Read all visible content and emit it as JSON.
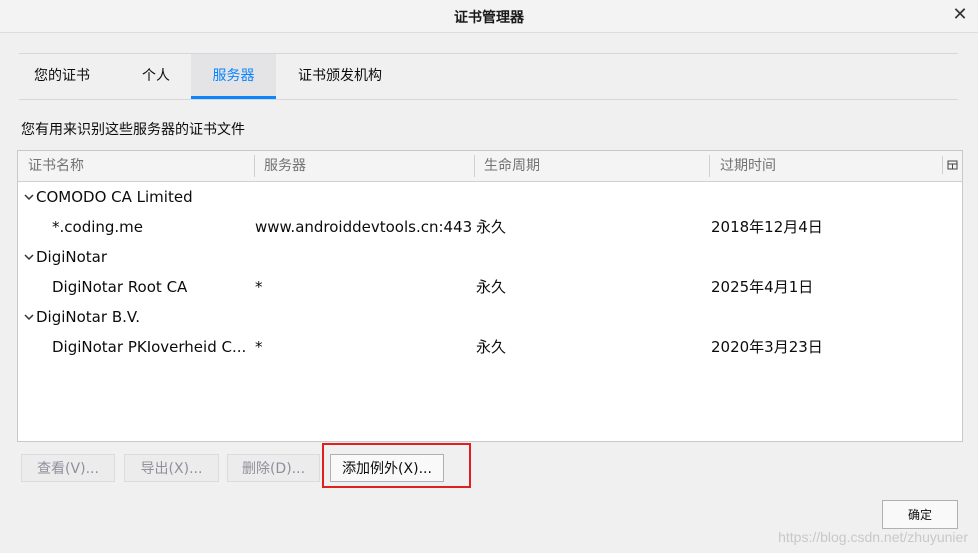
{
  "window": {
    "title": "证书管理器",
    "close_icon": "close-icon"
  },
  "tabs": [
    {
      "label": "您的证书",
      "selected": false
    },
    {
      "label": "个人",
      "selected": false
    },
    {
      "label": "服务器",
      "selected": true
    },
    {
      "label": "证书颁发机构",
      "selected": false
    }
  ],
  "description": "您有用来识别这些服务器的证书文件",
  "tree": {
    "columns": [
      "证书名称",
      "服务器",
      "生命周期",
      "过期时间"
    ],
    "column_picker_icon": "column-picker-icon",
    "groups": [
      {
        "name": "COMODO CA Limited",
        "expanded": true,
        "children": [
          {
            "name": "*.coding.me",
            "server": "www.androiddevtools.cn:443",
            "lifetime": "永久",
            "expires": "2018年12月4日"
          }
        ]
      },
      {
        "name": "DigiNotar",
        "expanded": true,
        "children": [
          {
            "name": "DigiNotar Root CA",
            "server": "*",
            "lifetime": "永久",
            "expires": "2025年4月1日"
          }
        ]
      },
      {
        "name": "DigiNotar B.V.",
        "expanded": true,
        "children": [
          {
            "name": "DigiNotar PKIoverheid C...",
            "server": "*",
            "lifetime": "永久",
            "expires": "2020年3月23日"
          }
        ]
      }
    ]
  },
  "buttons": {
    "view": "查看(V)...",
    "export": "导出(X)...",
    "delete": "删除(D)...",
    "add_exception": "添加例外(X)...",
    "ok": "确定"
  },
  "highlight_color": "#e02020",
  "accent_color": "#0a84ff",
  "watermark": "https://blog.csdn.net/zhuyunier"
}
